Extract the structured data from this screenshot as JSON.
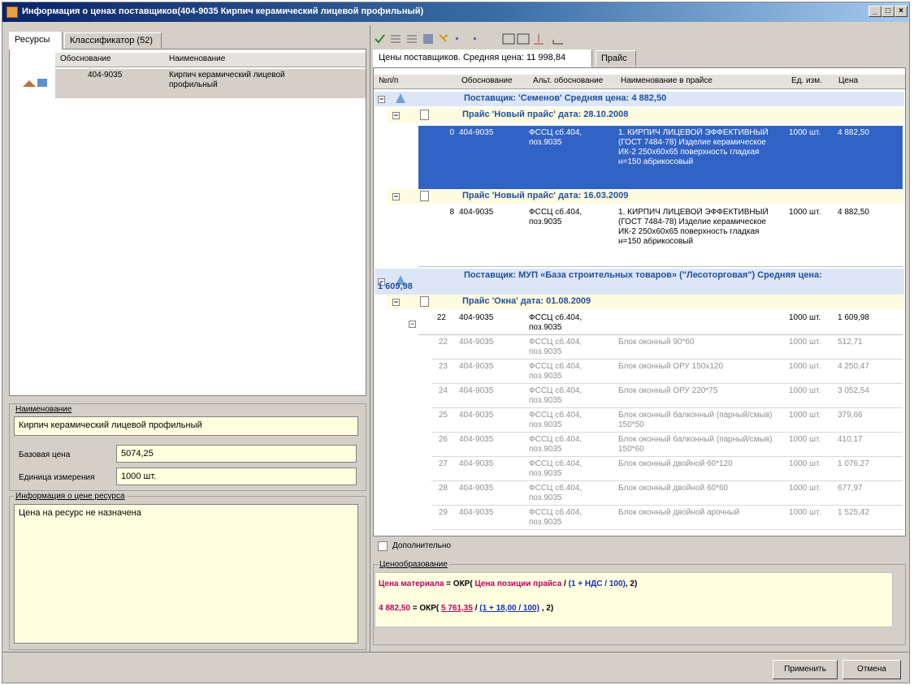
{
  "window": {
    "title": "Информация о ценах поставщиков(404-9035  Кирпич керамический лицевой профильный)",
    "min": "_",
    "max": "□",
    "close": "×"
  },
  "left": {
    "tabs": [
      "Ресурсы",
      "Классификатор (52)"
    ],
    "table_headers": [
      "Обоснование",
      "Наименование"
    ],
    "resource_row": {
      "code": "404-9035",
      "name": "Кирпич керамический лицевой профильный"
    },
    "name_label": "Наименование",
    "name_value": "Кирпич керамический лицевой профильный",
    "base_price_label": "Базовая цена",
    "base_price_value": "5074,25",
    "unit_label": "Единица измерения",
    "unit_value": "1000 шт.",
    "price_info_label": "Информация о цене ресурса",
    "price_info_value": "Цена на ресурс не назначена"
  },
  "right": {
    "tabs": [
      "Цены поставщиков. Средняя цена: 11 998,84",
      "Прайс"
    ],
    "headers": [
      "№п/п",
      "Обоснование",
      "Альт. обоснование",
      "Наименование в прайсе",
      "Ед. изм.",
      "Цена"
    ],
    "supplier1": "Поставщик: 'Семенов' Средняя цена: 4 882,50",
    "price1": "Прайс 'Новый прайс' дата: 28.10.2008",
    "price2": "Прайс 'Новый прайс' дата: 16.03.2009",
    "supplier2_line1": "Поставщик: МУП «База строительных товаров» (\"Лесоторговая\") Средняя цена:",
    "supplier2_line2": "1 609,98",
    "price3": "Прайс 'Окна' дата: 01.08.2009",
    "rows_main": [
      {
        "n": "0",
        "code": "404-9035",
        "alt": "ФССЦ сб.404, поз.9035",
        "name": "1. КИРПИЧ ЛИЦЕВОЙ ЭФФЕКТИВНЫЙ (ГОСТ 7484-78) Изделие керамическое ИК-2 250х60х65 поверхность гладкая н=150 абрикосовый",
        "unit": "1000 шт.",
        "price": "4 882,50"
      },
      {
        "n": "8",
        "code": "404-9035",
        "alt": "ФССЦ сб.404, поз.9035",
        "name": "1. КИРПИЧ ЛИЦЕВОЙ ЭФФЕКТИВНЫЙ (ГОСТ 7484-78) Изделие керамическое ИК-2 250х60х65 поверхность гладкая н=150 абрикосовый",
        "unit": "1000 шт.",
        "price": "4 882,50"
      },
      {
        "n": "22",
        "code": "404-9035",
        "alt": "ФССЦ сб.404, поз.9035",
        "name": "",
        "unit": "1000 шт.",
        "price": "1 609,98"
      }
    ],
    "rows_sub": [
      {
        "n": "22",
        "code": "404-9035",
        "alt": "ФССЦ сб.404, поз.9035",
        "name": "Блок оконный 90*60",
        "unit": "1000 шт.",
        "price": "512,71"
      },
      {
        "n": "23",
        "code": "404-9035",
        "alt": "ФССЦ сб.404, поз.9035",
        "name": "Блок оконный ОРУ 150х120",
        "unit": "1000 шт.",
        "price": "4 250,47"
      },
      {
        "n": "24",
        "code": "404-9035",
        "alt": "ФССЦ сб.404, поз.9035",
        "name": "Блок оконный ОРУ 220*75",
        "unit": "1000 шт.",
        "price": "3 052,54"
      },
      {
        "n": "25",
        "code": "404-9035",
        "alt": "ФССЦ сб.404, поз.9035",
        "name": "Блок оконный балконный (парный/смыв) 150*50",
        "unit": "1000 шт.",
        "price": "379,66"
      },
      {
        "n": "26",
        "code": "404-9035",
        "alt": "ФССЦ сб.404, поз.9035",
        "name": "Блок оконный балконный (парный/смыв) 150*60",
        "unit": "1000 шт.",
        "price": "410,17"
      },
      {
        "n": "27",
        "code": "404-9035",
        "alt": "ФССЦ сб.404, поз.9035",
        "name": "Блок оконный двойной 60*120",
        "unit": "1000 шт.",
        "price": "1 076,27"
      },
      {
        "n": "28",
        "code": "404-9035",
        "alt": "ФССЦ сб.404, поз.9035",
        "name": "Блок оконный двойной 60*60",
        "unit": "1000 шт.",
        "price": "677,97"
      },
      {
        "n": "29",
        "code": "404-9035",
        "alt": "ФССЦ сб.404, поз.9035",
        "name": "Блок оконный двойной арочный",
        "unit": "1000 шт.",
        "price": "1 525,42"
      }
    ],
    "additional_label": "Дополнительно",
    "pricing_label": "Ценообразование",
    "formula1_a": "Цена материала",
    "formula1_b": " = ОКР( ",
    "formula1_c": "Цена позиции прайса",
    "formula1_d": " / ",
    "formula1_e": "(1 + НДС / 100)",
    "formula1_f": ", 2)",
    "formula2_a": "4 882,50",
    "formula2_b": " = ОКР( ",
    "formula2_c": "5 761,35",
    "formula2_d": " / ",
    "formula2_e": "(1 + 18,00 / 100)",
    "formula2_f": " , 2)"
  },
  "buttons": {
    "apply": "Применить",
    "cancel": "Отмена"
  }
}
